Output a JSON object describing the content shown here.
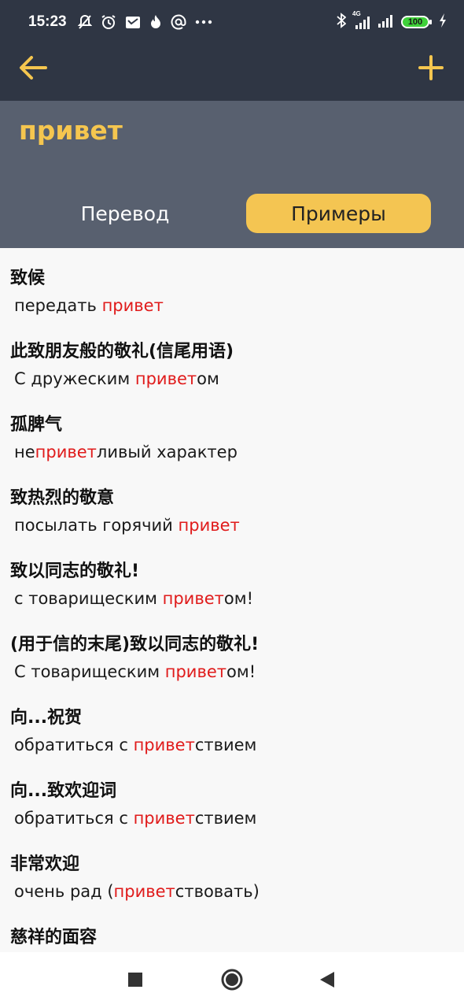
{
  "status_bar": {
    "time": "15:23",
    "network": "4G",
    "battery": "100"
  },
  "header": {
    "word": "привет",
    "tabs": [
      {
        "label": "Перевод",
        "active": false
      },
      {
        "label": "Примеры",
        "active": true
      }
    ]
  },
  "examples": [
    {
      "cn": "致候",
      "ru_before": "передать ",
      "ru_hl": "привет",
      "ru_after": ""
    },
    {
      "cn": "此致朋友般的敬礼(信尾用语)",
      "ru_before": "С дружеским ",
      "ru_hl": "привет",
      "ru_after": "ом"
    },
    {
      "cn": "孤脾气",
      "ru_before": "не",
      "ru_hl": "привет",
      "ru_after": "ливый характер"
    },
    {
      "cn": "致热烈的敬意",
      "ru_before": "посылать горячий ",
      "ru_hl": "привет",
      "ru_after": ""
    },
    {
      "cn": "致以同志的敬礼!",
      "ru_before": "с товарищеским ",
      "ru_hl": "привет",
      "ru_after": "ом!"
    },
    {
      "cn": "(用于信的末尾)致以同志的敬礼!",
      "ru_before": "С товарищеским ",
      "ru_hl": "привет",
      "ru_after": "ом!"
    },
    {
      "cn": "向...祝贺",
      "ru_before": "обратиться с ",
      "ru_hl": "привет",
      "ru_after": "ствием"
    },
    {
      "cn": "向...致欢迎词",
      "ru_before": "обратиться с ",
      "ru_hl": "привет",
      "ru_after": "ствием"
    },
    {
      "cn": "非常欢迎",
      "ru_before": "очень рад (",
      "ru_hl": "привет",
      "ru_after": "ствовать)"
    },
    {
      "cn": "慈祥的面容",
      "ru_before": "",
      "ru_hl": "",
      "ru_after": ""
    }
  ],
  "colors": {
    "accent": "#f5c64f",
    "highlight": "#e01b1b",
    "appbar": "#2f3644",
    "header": "#58606f"
  }
}
